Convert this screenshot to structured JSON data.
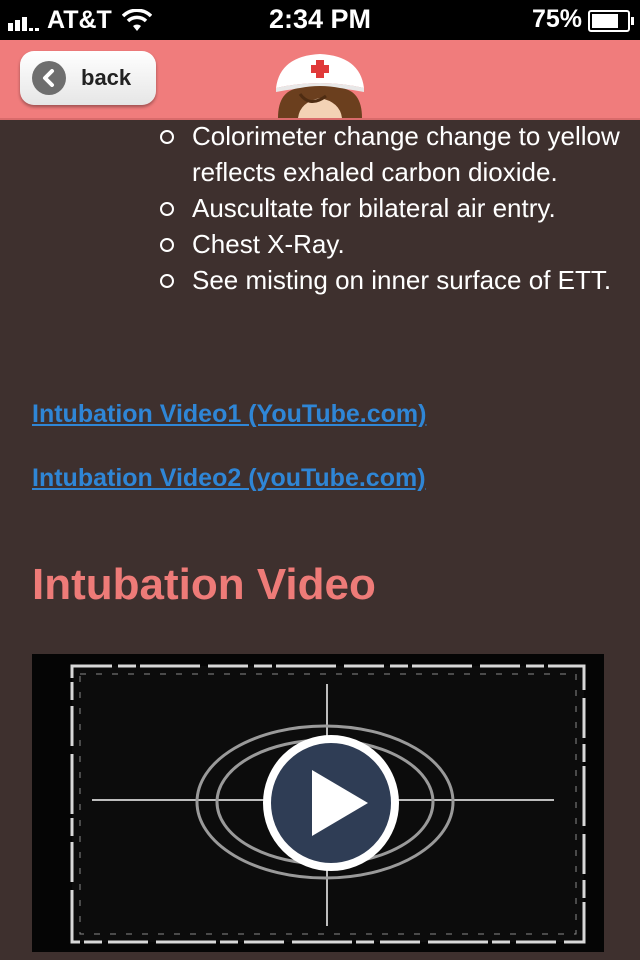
{
  "status_bar": {
    "carrier": "AT&T",
    "time": "2:34 PM",
    "battery": "75%",
    "battery_level": 0.75
  },
  "nav": {
    "back_label": "back",
    "logo_icon": "nurse-cap-icon"
  },
  "content": {
    "bullets": [
      "Colorimeter change change to yellow reflects exhaled carbon dioxide.",
      "Auscultate for bilateral air entry.",
      "Chest X-Ray.",
      "See misting on inner surface of ETT."
    ],
    "links": [
      "Intubation Video1 (YouTube.com)",
      "Intubation Video2 (youTube.com)"
    ],
    "section_title": "Intubation Video",
    "video_play_icon": "play-icon"
  },
  "colors": {
    "background": "#3e302e",
    "navbar": "#f07c7c",
    "title": "#ee7b78",
    "link": "#2f86d6"
  }
}
